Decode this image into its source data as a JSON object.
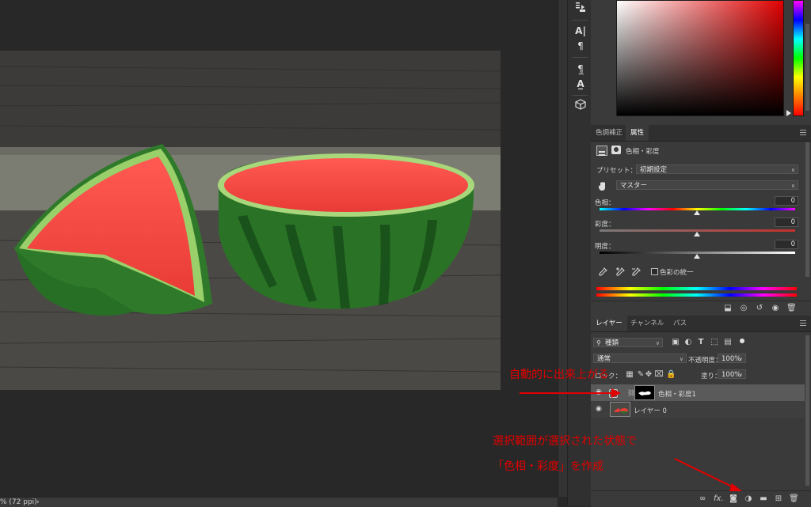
{
  "status": {
    "zoom_text": "% (72 ppi)",
    "chevron": "›"
  },
  "toolstrip": {
    "icons": [
      "history-icon",
      "character-icon",
      "paragraph-icon",
      "paragraph-style-icon",
      "character-style-icon",
      "3d-icon"
    ]
  },
  "adjust_panel": {
    "tabs": [
      "色調補正",
      "属性"
    ],
    "active_tab": 1,
    "adjust_title": "色相・彩度",
    "preset_label": "プリセット：",
    "preset_value": "初期設定",
    "channel_value": "マスター",
    "hue_label": "色相：",
    "hue_value": "0",
    "saturation_label": "彩度：",
    "saturation_value": "0",
    "lightness_label": "明度：",
    "lightness_value": "0",
    "colorize_label": "色彩の統一"
  },
  "layers_panel": {
    "tabs": [
      "レイヤー",
      "チャンネル",
      "パス"
    ],
    "active_tab": 0,
    "filter_value": "種類",
    "blend_mode": "通常",
    "opacity_label": "不透明度：",
    "opacity_value": "100%",
    "lock_label": "ロック：",
    "fill_label": "塗り：",
    "fill_value": "100%",
    "layers": [
      {
        "name": "色相・彩度1",
        "selected": true
      },
      {
        "name": "レイヤー 0",
        "selected": false
      }
    ],
    "footer_icons": [
      "link-icon",
      "fx-icon",
      "mask-icon",
      "adjustment-icon",
      "folder-icon",
      "new-layer-icon",
      "trash-icon"
    ],
    "fx_label": "fx."
  },
  "annotations": {
    "auto_created": "自動的に出来上がる",
    "line1": "選択範囲が選択された状態で",
    "line2": "「色相・彩度」を作成"
  },
  "colors": {
    "annotation": "#e30000",
    "panel_bg": "#3a3a3a",
    "canvas_bg": "#282828"
  }
}
